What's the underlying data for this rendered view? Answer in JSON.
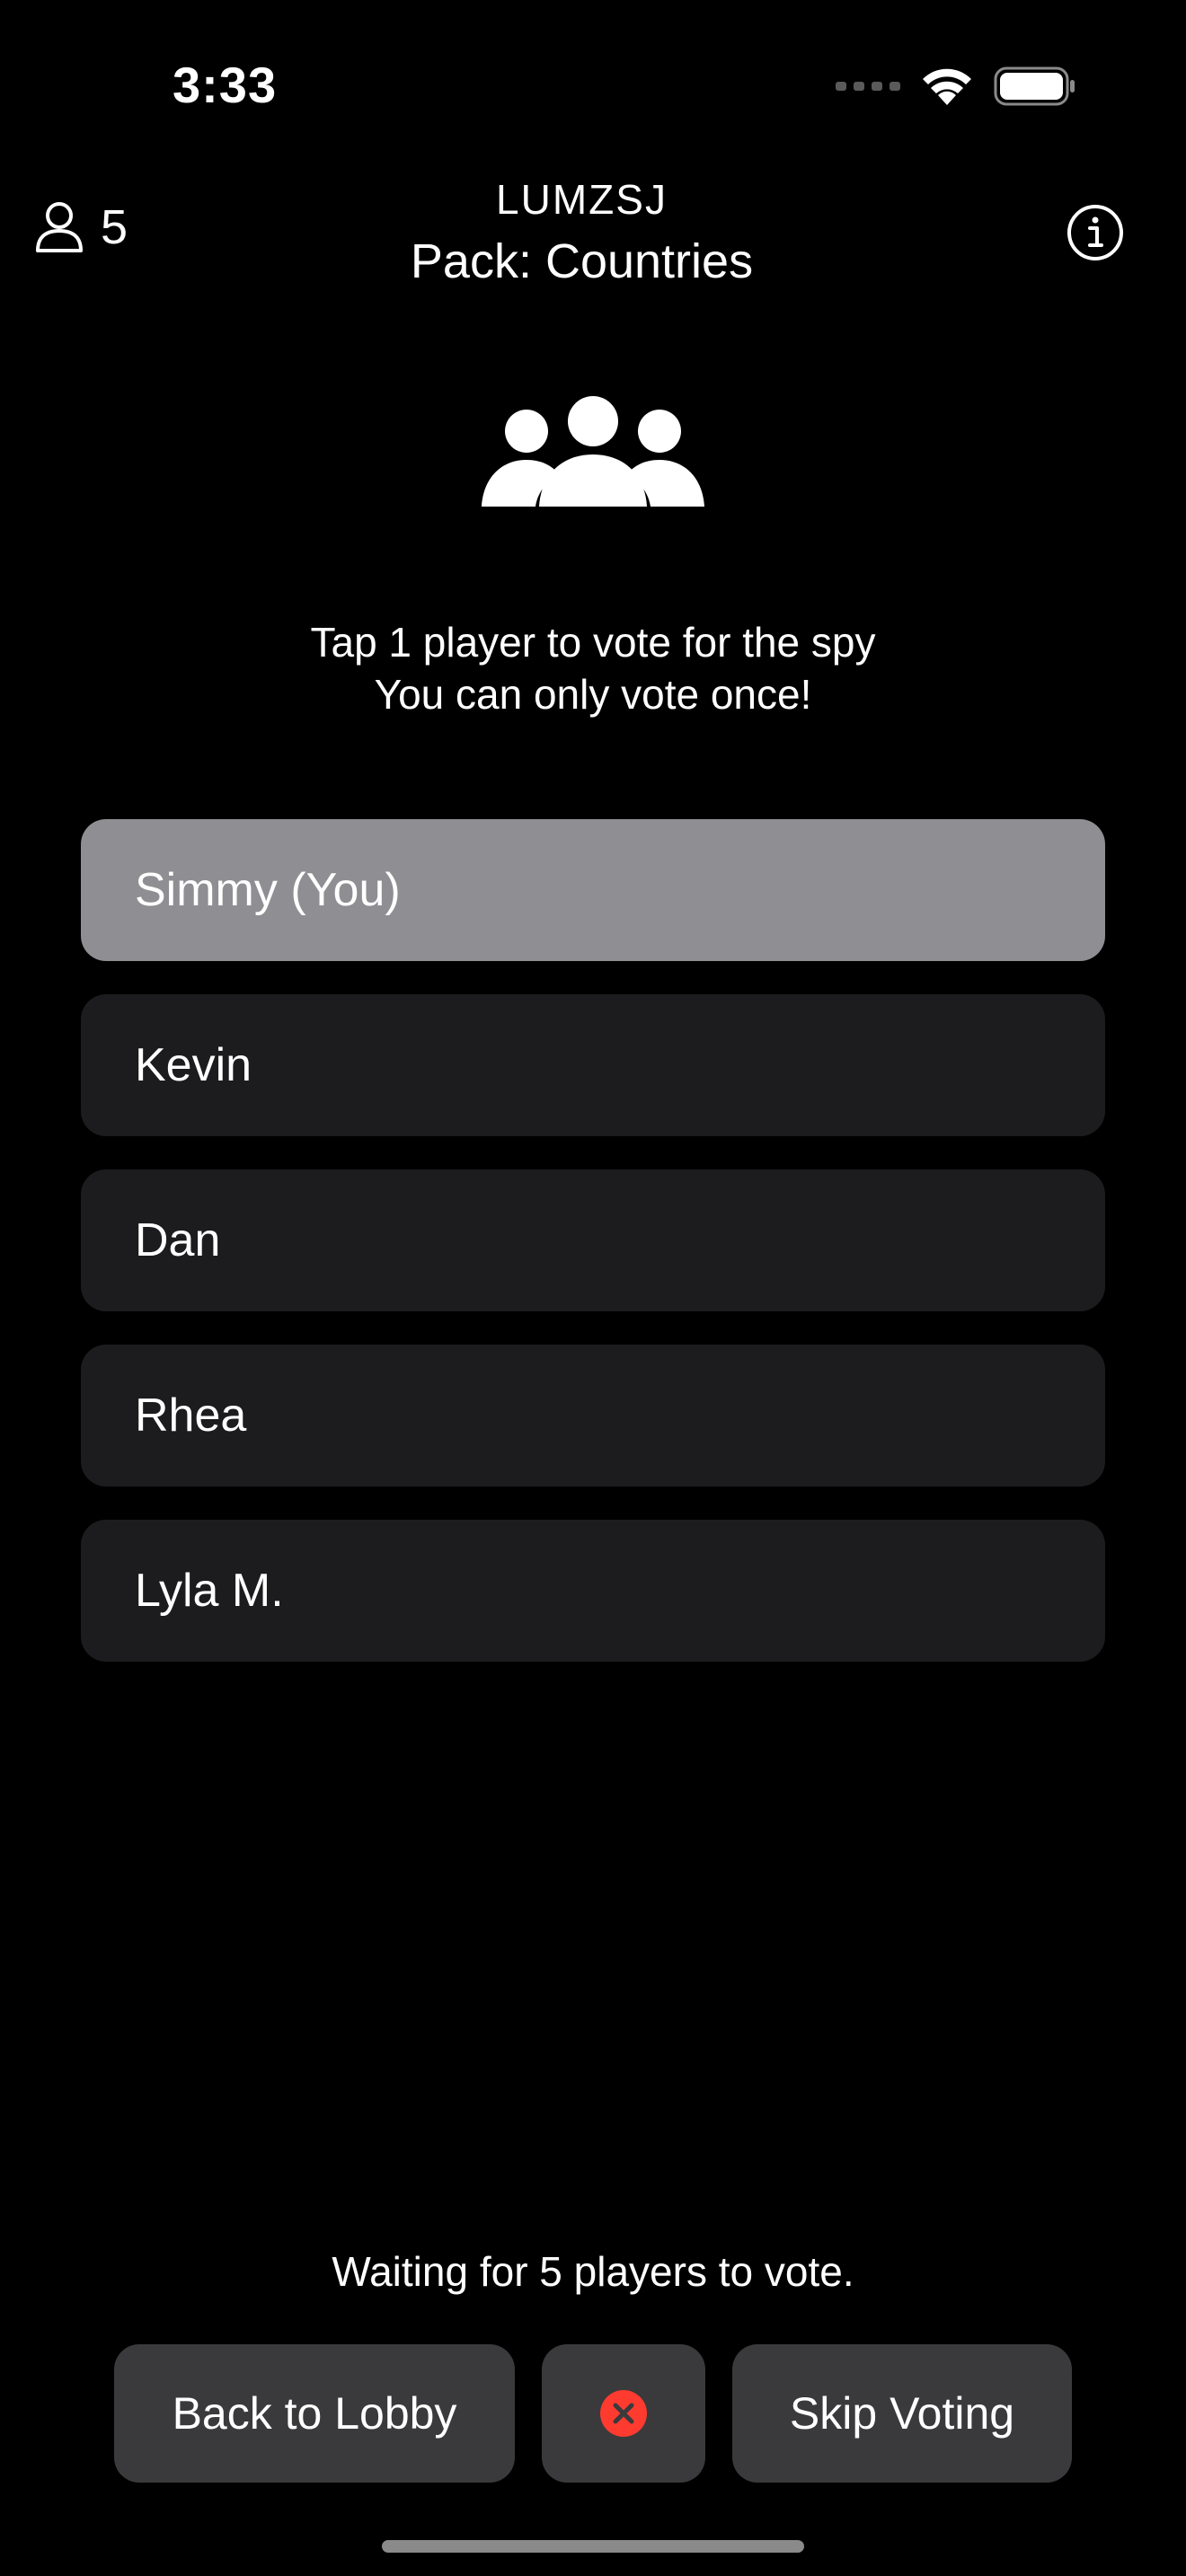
{
  "status_bar": {
    "time": "3:33",
    "icons": [
      "cellular-signal-icon",
      "wifi-icon",
      "battery-icon"
    ]
  },
  "header": {
    "player_count": "5",
    "player_icon": "person-icon",
    "room_code": "LUMZSJ",
    "pack": "Pack: Countries",
    "info_icon": "info-icon"
  },
  "vote": {
    "icon": "group-icon",
    "instruction_line1": "Tap 1 player to vote for the spy",
    "instruction_line2": "You can only vote once!",
    "players": [
      {
        "name": "Simmy (You)",
        "selected": true
      },
      {
        "name": "Kevin",
        "selected": false
      },
      {
        "name": "Dan",
        "selected": false
      },
      {
        "name": "Rhea",
        "selected": false
      },
      {
        "name": "Lyla M.",
        "selected": false
      }
    ],
    "waiting_text": "Waiting for 5 players to vote."
  },
  "actions": {
    "back_label": "Back to Lobby",
    "cancel_icon": "close-circle-icon",
    "skip_label": "Skip Voting"
  },
  "colors": {
    "background": "#000000",
    "row": "#1c1c1e",
    "row_selected": "#8e8e93",
    "button": "#3a3a3c",
    "cancel_red": "#ff3b30"
  }
}
